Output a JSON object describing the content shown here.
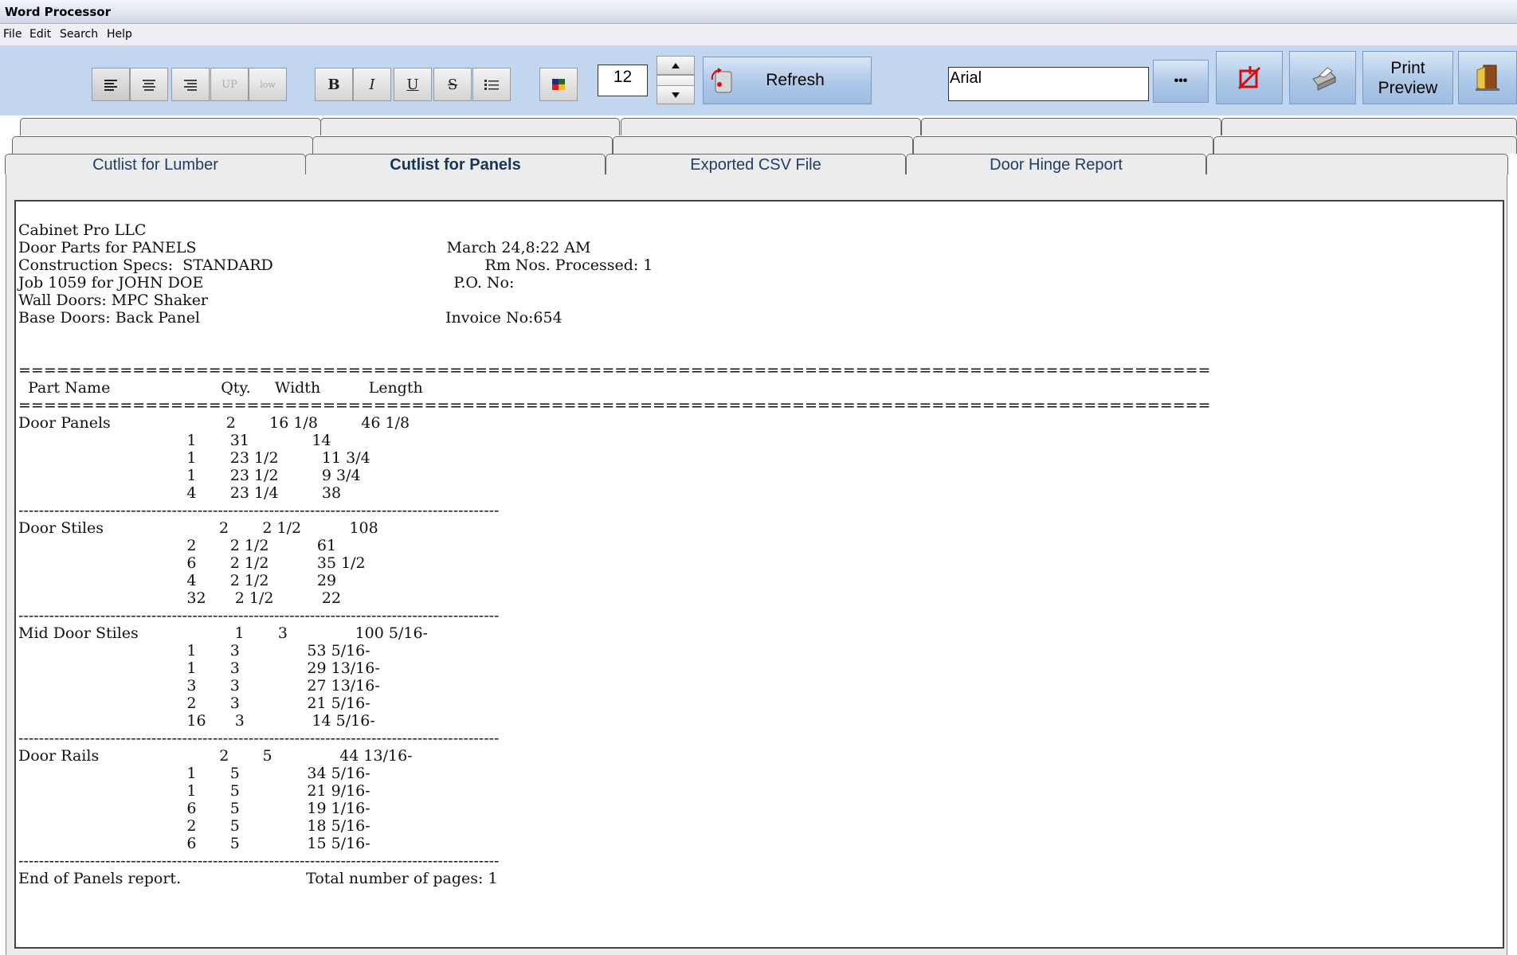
{
  "window": {
    "title": "Word Processor"
  },
  "menu": [
    "File",
    "Edit",
    "Search",
    "Help"
  ],
  "toolbar": {
    "align_buttons": [
      "align-left",
      "align-center",
      "align-right"
    ],
    "case_up": "UP",
    "case_low": "low",
    "bold": "B",
    "italic": "I",
    "underline": "U",
    "strike": "S",
    "font_size": "12",
    "refresh_label": "Refresh",
    "font_name": "Arial",
    "more_label": "•••",
    "print_preview_line1": "Print",
    "print_preview_line2": "Preview"
  },
  "tabs": {
    "labels": [
      "Cutlist for Lumber",
      "Cutlist for Panels",
      "Exported CSV File",
      "Door Hinge Report"
    ],
    "active": "Cutlist for Panels"
  },
  "report": {
    "lines": [
      "Cabinet Pro LLC",
      "Door Parts for PANELS                                                    March 24,8:22 AM",
      "Construction Specs:  STANDARD                                            Rm Nos. Processed: 1",
      "Job 1059 for JOHN DOE                                                    P.O. No:",
      "Wall Doors: MPC Shaker",
      "Base Doors: Back Panel                                                   Invoice No:654",
      "",
      "",
      "==============================================================================================",
      "  Part Name                       Qty.     Width          Length",
      "==============================================================================================",
      "Door Panels                        2       16 1/8         46 1/8",
      "                                   1       31             14",
      "                                   1       23 1/2         11 3/4",
      "                                   1       23 1/2         9 3/4",
      "                                   4       23 1/4         38",
      "----------------------------------------------------------------------------------------------",
      "Door Stiles                        2       2 1/2          108",
      "                                   2       2 1/2          61",
      "                                   6       2 1/2          35 1/2",
      "                                   4       2 1/2          29",
      "                                   32      2 1/2          22",
      "----------------------------------------------------------------------------------------------",
      "Mid Door Stiles                    1       3              100 5/16-",
      "                                   1       3              53 5/16-",
      "                                   1       3              29 13/16-",
      "                                   3       3              27 13/16-",
      "                                   2       3              21 5/16-",
      "                                   16      3              14 5/16-",
      "----------------------------------------------------------------------------------------------",
      "Door Rails                         2       5              44 13/16-",
      "                                   1       5              34 5/16-",
      "                                   1       5              21 9/16-",
      "                                   6       5              19 1/16-",
      "                                   2       5              18 5/16-",
      "                                   6       5              15 5/16-",
      "----------------------------------------------------------------------------------------------",
      "End of Panels report.                          Total number of pages: 1"
    ]
  }
}
